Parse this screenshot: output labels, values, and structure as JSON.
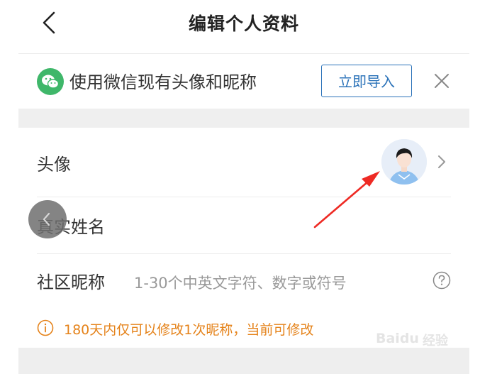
{
  "header": {
    "title": "编辑个人资料"
  },
  "banner": {
    "text": "使用微信现有头像和昵称",
    "import_label": "立即导入"
  },
  "profile": {
    "avatar_label": "头像",
    "real_name_label": "真实姓名",
    "nickname_label": "社区昵称",
    "nickname_placeholder": "1-30个中英文字符、数字或符号"
  },
  "notice": {
    "text": "180天内仅可以修改1次昵称，当前可修改"
  },
  "watermark": {
    "text": "Baidu",
    "text2": "经验"
  },
  "colors": {
    "accent": "#2c73b9",
    "wechat": "#3fb76a",
    "warning": "#e5831b",
    "annotation": "#ee2a24"
  },
  "icons": [
    "back-arrow-icon",
    "wechat-icon",
    "close-icon",
    "chevron-right-icon",
    "help-icon",
    "info-icon",
    "avatar-image"
  ]
}
